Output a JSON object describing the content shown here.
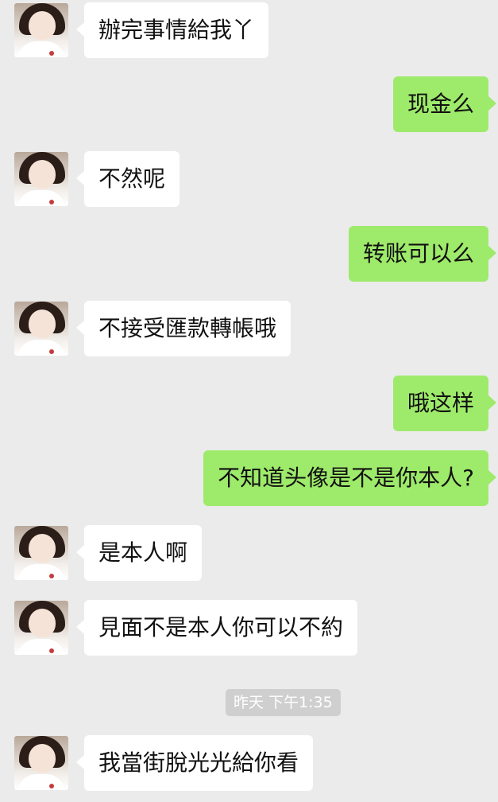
{
  "messages": [
    {
      "side": "left",
      "text": "辦完事情給我丫"
    },
    {
      "side": "right",
      "text": "现金么"
    },
    {
      "side": "left",
      "text": "不然呢"
    },
    {
      "side": "right",
      "text": "转账可以么"
    },
    {
      "side": "left",
      "text": "不接受匯款轉帳哦"
    },
    {
      "side": "right",
      "text": "哦这样"
    },
    {
      "side": "right",
      "text": "不知道头像是不是你本人?"
    },
    {
      "side": "left",
      "text": "是本人啊"
    },
    {
      "side": "left",
      "text": "見面不是本人你可以不約"
    },
    {
      "side": "left",
      "text": "我當街脫光光給你看"
    }
  ],
  "timestamp": "昨天 下午1:35",
  "colors": {
    "background": "#ebebeb",
    "incoming_bubble": "#ffffff",
    "outgoing_bubble": "#9eea6a",
    "timestamp_badge": "#cfcfcf"
  },
  "icons": {
    "contact_avatar": "contact-avatar-photo"
  }
}
